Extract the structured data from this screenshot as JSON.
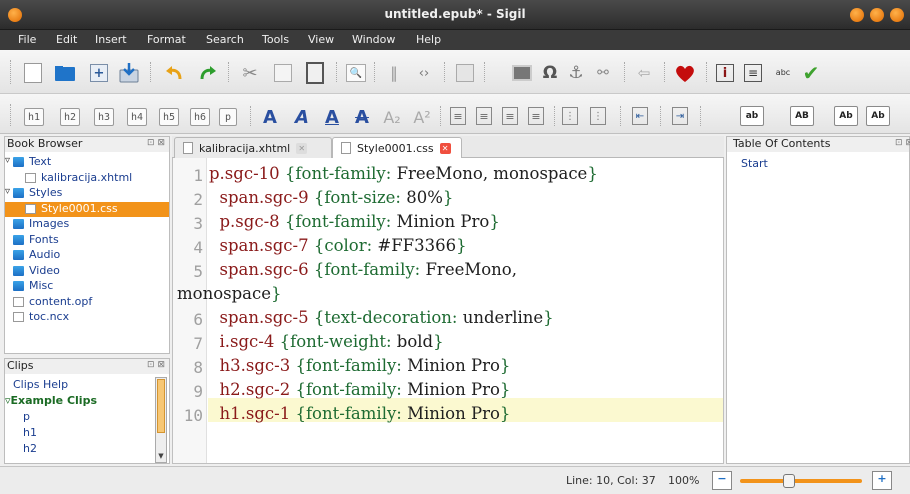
{
  "window": {
    "title": "untitled.epub* - Sigil"
  },
  "menu": [
    "File",
    "Edit",
    "Insert",
    "Format",
    "Search",
    "Tools",
    "View",
    "Window",
    "Help"
  ],
  "heading_buttons": [
    "h1",
    "h2",
    "h3",
    "h4",
    "h5",
    "h6",
    "p"
  ],
  "case_buttons": [
    "ab",
    "AB",
    "Ab",
    "Ab"
  ],
  "spellcheck_label": "abc",
  "book_browser": {
    "title": "Book Browser",
    "items": [
      {
        "label": "Text",
        "type": "folder",
        "level": 0,
        "expanded": true
      },
      {
        "label": "kalibracija.xhtml",
        "type": "file",
        "level": 1
      },
      {
        "label": "Styles",
        "type": "folder",
        "level": 0,
        "expanded": true
      },
      {
        "label": "Style0001.css",
        "type": "file",
        "level": 1,
        "selected": true
      },
      {
        "label": "Images",
        "type": "folder",
        "level": 0
      },
      {
        "label": "Fonts",
        "type": "folder",
        "level": 0
      },
      {
        "label": "Audio",
        "type": "folder",
        "level": 0
      },
      {
        "label": "Video",
        "type": "folder",
        "level": 0
      },
      {
        "label": "Misc",
        "type": "folder",
        "level": 0
      },
      {
        "label": "content.opf",
        "type": "file",
        "level": 0
      },
      {
        "label": "toc.ncx",
        "type": "file",
        "level": 0
      }
    ]
  },
  "clips": {
    "title": "Clips",
    "items": [
      {
        "label": "Clips Help",
        "bold": false
      },
      {
        "label": "Example Clips",
        "bold": true
      },
      {
        "label": "p",
        "bold": false
      },
      {
        "label": "h1",
        "bold": false
      },
      {
        "label": "h2",
        "bold": false
      }
    ]
  },
  "tabs": [
    {
      "label": "kalibracija.xhtml",
      "active": false
    },
    {
      "label": "Style0001.css",
      "active": true
    }
  ],
  "editor": {
    "lines": [
      {
        "num": "1",
        "sel": "p.sgc-10",
        "prop": "font-family",
        "val": "FreeMono, monospace"
      },
      {
        "num": "2",
        "sel": "span.sgc-9",
        "prop": "font-size",
        "val": "80%"
      },
      {
        "num": "3",
        "sel": "p.sgc-8",
        "prop": "font-family",
        "val": "Minion Pro"
      },
      {
        "num": "4",
        "sel": "span.sgc-7",
        "prop": "color",
        "val": "#FF3366"
      },
      {
        "num": "5",
        "sel": "span.sgc-6",
        "prop": "font-family",
        "val": "FreeMono,",
        "wrap": "monospace"
      },
      {
        "num": "6",
        "sel": "span.sgc-5",
        "prop": "text-decoration",
        "val": "underline"
      },
      {
        "num": "7",
        "sel": "i.sgc-4",
        "prop": "font-weight",
        "val": "bold"
      },
      {
        "num": "8",
        "sel": "h3.sgc-3",
        "prop": "font-family",
        "val": "Minion Pro"
      },
      {
        "num": "9",
        "sel": "h2.sgc-2",
        "prop": "font-family",
        "val": "Minion Pro"
      },
      {
        "num": "10",
        "sel": "h1.sgc-1",
        "prop": "font-family",
        "val": "Minion Pro"
      }
    ]
  },
  "toc": {
    "title": "Table Of Contents",
    "items": [
      "Start"
    ]
  },
  "status": {
    "position": "Line: 10, Col: 37",
    "zoom": "100%",
    "zoom_level": 0.4
  },
  "colors": {
    "accent": "#f2931a",
    "titlebar": "#2c2c2c",
    "current_line": "#fbf9d0"
  }
}
